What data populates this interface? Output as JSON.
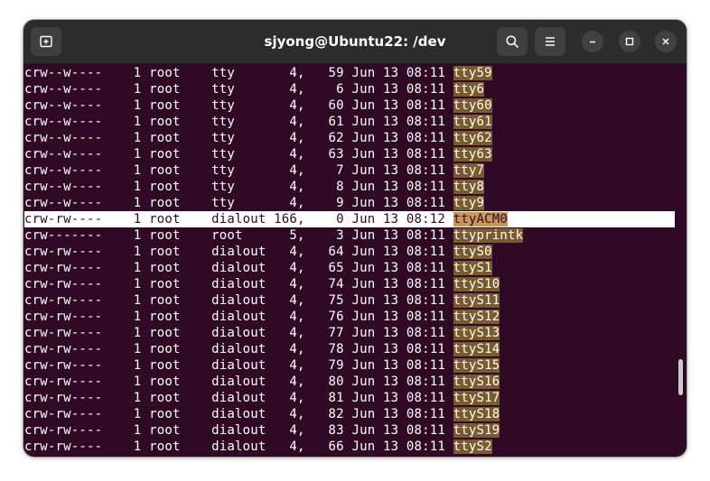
{
  "window": {
    "title": "sjyong@Ubuntu22: /dev"
  },
  "icons": {
    "new_tab": "new-tab-icon",
    "search": "search-icon",
    "menu": "hamburger-menu-icon",
    "minimize": "minimize-icon",
    "maximize": "maximize-icon",
    "close": "close-icon"
  },
  "colors": {
    "terminal_bg": "#300a24",
    "titlebar_bg": "#2c2c2c",
    "filename_highlight": "#7a5b2e"
  },
  "listing": [
    {
      "perm": "crw--w----",
      "links": "1",
      "owner": "root",
      "group": "tty",
      "major": "4,",
      "minor": "59",
      "date": "Jun 13 08:11",
      "name": "tty59"
    },
    {
      "perm": "crw--w----",
      "links": "1",
      "owner": "root",
      "group": "tty",
      "major": "4,",
      "minor": "6",
      "date": "Jun 13 08:11",
      "name": "tty6"
    },
    {
      "perm": "crw--w----",
      "links": "1",
      "owner": "root",
      "group": "tty",
      "major": "4,",
      "minor": "60",
      "date": "Jun 13 08:11",
      "name": "tty60"
    },
    {
      "perm": "crw--w----",
      "links": "1",
      "owner": "root",
      "group": "tty",
      "major": "4,",
      "minor": "61",
      "date": "Jun 13 08:11",
      "name": "tty61"
    },
    {
      "perm": "crw--w----",
      "links": "1",
      "owner": "root",
      "group": "tty",
      "major": "4,",
      "minor": "62",
      "date": "Jun 13 08:11",
      "name": "tty62"
    },
    {
      "perm": "crw--w----",
      "links": "1",
      "owner": "root",
      "group": "tty",
      "major": "4,",
      "minor": "63",
      "date": "Jun 13 08:11",
      "name": "tty63"
    },
    {
      "perm": "crw--w----",
      "links": "1",
      "owner": "root",
      "group": "tty",
      "major": "4,",
      "minor": "7",
      "date": "Jun 13 08:11",
      "name": "tty7"
    },
    {
      "perm": "crw--w----",
      "links": "1",
      "owner": "root",
      "group": "tty",
      "major": "4,",
      "minor": "8",
      "date": "Jun 13 08:11",
      "name": "tty8"
    },
    {
      "perm": "crw--w----",
      "links": "1",
      "owner": "root",
      "group": "tty",
      "major": "4,",
      "minor": "9",
      "date": "Jun 13 08:11",
      "name": "tty9"
    },
    {
      "perm": "crw-rw----",
      "links": "1",
      "owner": "root",
      "group": "dialout",
      "major": "166,",
      "minor": "0",
      "date": "Jun 13 08:12",
      "name": "ttyACM0",
      "selected": true
    },
    {
      "perm": "crw-------",
      "links": "1",
      "owner": "root",
      "group": "root",
      "major": "5,",
      "minor": "3",
      "date": "Jun 13 08:11",
      "name": "ttyprintk"
    },
    {
      "perm": "crw-rw----",
      "links": "1",
      "owner": "root",
      "group": "dialout",
      "major": "4,",
      "minor": "64",
      "date": "Jun 13 08:11",
      "name": "ttyS0"
    },
    {
      "perm": "crw-rw----",
      "links": "1",
      "owner": "root",
      "group": "dialout",
      "major": "4,",
      "minor": "65",
      "date": "Jun 13 08:11",
      "name": "ttyS1"
    },
    {
      "perm": "crw-rw----",
      "links": "1",
      "owner": "root",
      "group": "dialout",
      "major": "4,",
      "minor": "74",
      "date": "Jun 13 08:11",
      "name": "ttyS10"
    },
    {
      "perm": "crw-rw----",
      "links": "1",
      "owner": "root",
      "group": "dialout",
      "major": "4,",
      "minor": "75",
      "date": "Jun 13 08:11",
      "name": "ttyS11"
    },
    {
      "perm": "crw-rw----",
      "links": "1",
      "owner": "root",
      "group": "dialout",
      "major": "4,",
      "minor": "76",
      "date": "Jun 13 08:11",
      "name": "ttyS12"
    },
    {
      "perm": "crw-rw----",
      "links": "1",
      "owner": "root",
      "group": "dialout",
      "major": "4,",
      "minor": "77",
      "date": "Jun 13 08:11",
      "name": "ttyS13"
    },
    {
      "perm": "crw-rw----",
      "links": "1",
      "owner": "root",
      "group": "dialout",
      "major": "4,",
      "minor": "78",
      "date": "Jun 13 08:11",
      "name": "ttyS14"
    },
    {
      "perm": "crw-rw----",
      "links": "1",
      "owner": "root",
      "group": "dialout",
      "major": "4,",
      "minor": "79",
      "date": "Jun 13 08:11",
      "name": "ttyS15"
    },
    {
      "perm": "crw-rw----",
      "links": "1",
      "owner": "root",
      "group": "dialout",
      "major": "4,",
      "minor": "80",
      "date": "Jun 13 08:11",
      "name": "ttyS16"
    },
    {
      "perm": "crw-rw----",
      "links": "1",
      "owner": "root",
      "group": "dialout",
      "major": "4,",
      "minor": "81",
      "date": "Jun 13 08:11",
      "name": "ttyS17"
    },
    {
      "perm": "crw-rw----",
      "links": "1",
      "owner": "root",
      "group": "dialout",
      "major": "4,",
      "minor": "82",
      "date": "Jun 13 08:11",
      "name": "ttyS18"
    },
    {
      "perm": "crw-rw----",
      "links": "1",
      "owner": "root",
      "group": "dialout",
      "major": "4,",
      "minor": "83",
      "date": "Jun 13 08:11",
      "name": "ttyS19"
    },
    {
      "perm": "crw-rw----",
      "links": "1",
      "owner": "root",
      "group": "dialout",
      "major": "4,",
      "minor": "66",
      "date": "Jun 13 08:11",
      "name": "ttyS2"
    }
  ]
}
